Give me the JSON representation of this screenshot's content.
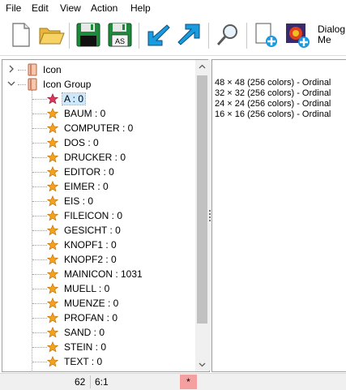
{
  "menu": {
    "items": [
      {
        "label": "File"
      },
      {
        "label": "Edit"
      },
      {
        "label": "View"
      },
      {
        "label": "Action"
      },
      {
        "label": "Help"
      }
    ]
  },
  "toolbar": {
    "buttons": [
      {
        "icon": "new-document-icon"
      },
      {
        "icon": "open-folder-icon"
      },
      {
        "icon": "save-floppy-icon"
      },
      {
        "icon": "save-as-floppy-icon",
        "badge": "AS"
      },
      {
        "icon": "import-arrow-icon"
      },
      {
        "icon": "export-arrow-icon"
      },
      {
        "icon": "search-magnifier-icon"
      },
      {
        "icon": "insert-resource-icon"
      },
      {
        "icon": "insert-image-icon"
      }
    ],
    "dialog_label_line1": "Dialog",
    "dialog_label_line2": "Me"
  },
  "tree": {
    "nodes": [
      {
        "label": "Icon",
        "level": 0,
        "expanded": false
      },
      {
        "label": "Icon Group",
        "level": 0,
        "expanded": true
      },
      {
        "label": "A : 0",
        "level": 1,
        "selected": true
      },
      {
        "label": "BAUM : 0",
        "level": 1
      },
      {
        "label": "COMPUTER : 0",
        "level": 1
      },
      {
        "label": "DOS : 0",
        "level": 1
      },
      {
        "label": "DRUCKER : 0",
        "level": 1
      },
      {
        "label": "EDITOR : 0",
        "level": 1
      },
      {
        "label": "EIMER : 0",
        "level": 1
      },
      {
        "label": "EIS : 0",
        "level": 1
      },
      {
        "label": "FILEICON : 0",
        "level": 1
      },
      {
        "label": "GESICHT : 0",
        "level": 1
      },
      {
        "label": "KNOPF1 : 0",
        "level": 1
      },
      {
        "label": "KNOPF2 : 0",
        "level": 1
      },
      {
        "label": "MAINICON : 1031",
        "level": 1
      },
      {
        "label": "MUELL : 0",
        "level": 1
      },
      {
        "label": "MUENZE : 0",
        "level": 1
      },
      {
        "label": "PROFAN : 0",
        "level": 1
      },
      {
        "label": "SAND : 0",
        "level": 1
      },
      {
        "label": "STEIN : 0",
        "level": 1
      },
      {
        "label": "TEXT : 0",
        "level": 1
      }
    ]
  },
  "details": {
    "lines": [
      "48 × 48 (256 colors) - Ordinal",
      "32 × 32 (256 colors) - Ordinal",
      "24 × 24 (256 colors) - Ordinal",
      "16 × 16 (256 colors) - Ordinal"
    ]
  },
  "status": {
    "code": "62",
    "position": "6:1",
    "modified": "*"
  },
  "colors": {
    "selection": "#cce8ff",
    "modified_bg": "#f4a0a0",
    "star_selected": "#d9365b",
    "star_normal": "#f4a020"
  }
}
